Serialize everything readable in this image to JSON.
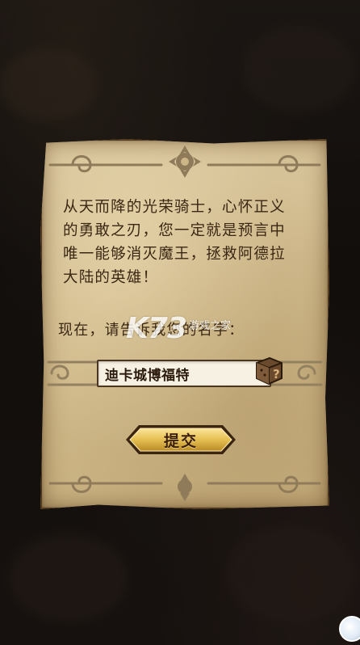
{
  "dialog": {
    "story_text": "从天而降的光荣骑士，心怀正义\n的勇敢之刃，您一定就是预言中\n唯一能够消灭魔王，拯救阿德拉\n大陆的英雄！",
    "prompt_text": "现在，请告诉我您的名字：",
    "name_input": {
      "value": "迪卡城博福特"
    },
    "random_name_icon": "dice-icon",
    "submit_label": "提交"
  },
  "watermark": {
    "logo": "K73",
    "text": "游戏之家"
  },
  "colors": {
    "parchment": "#d3bf92",
    "ink": "#3a2714",
    "button_gold": "#e8c45a",
    "frame_dark": "#4a3520"
  }
}
